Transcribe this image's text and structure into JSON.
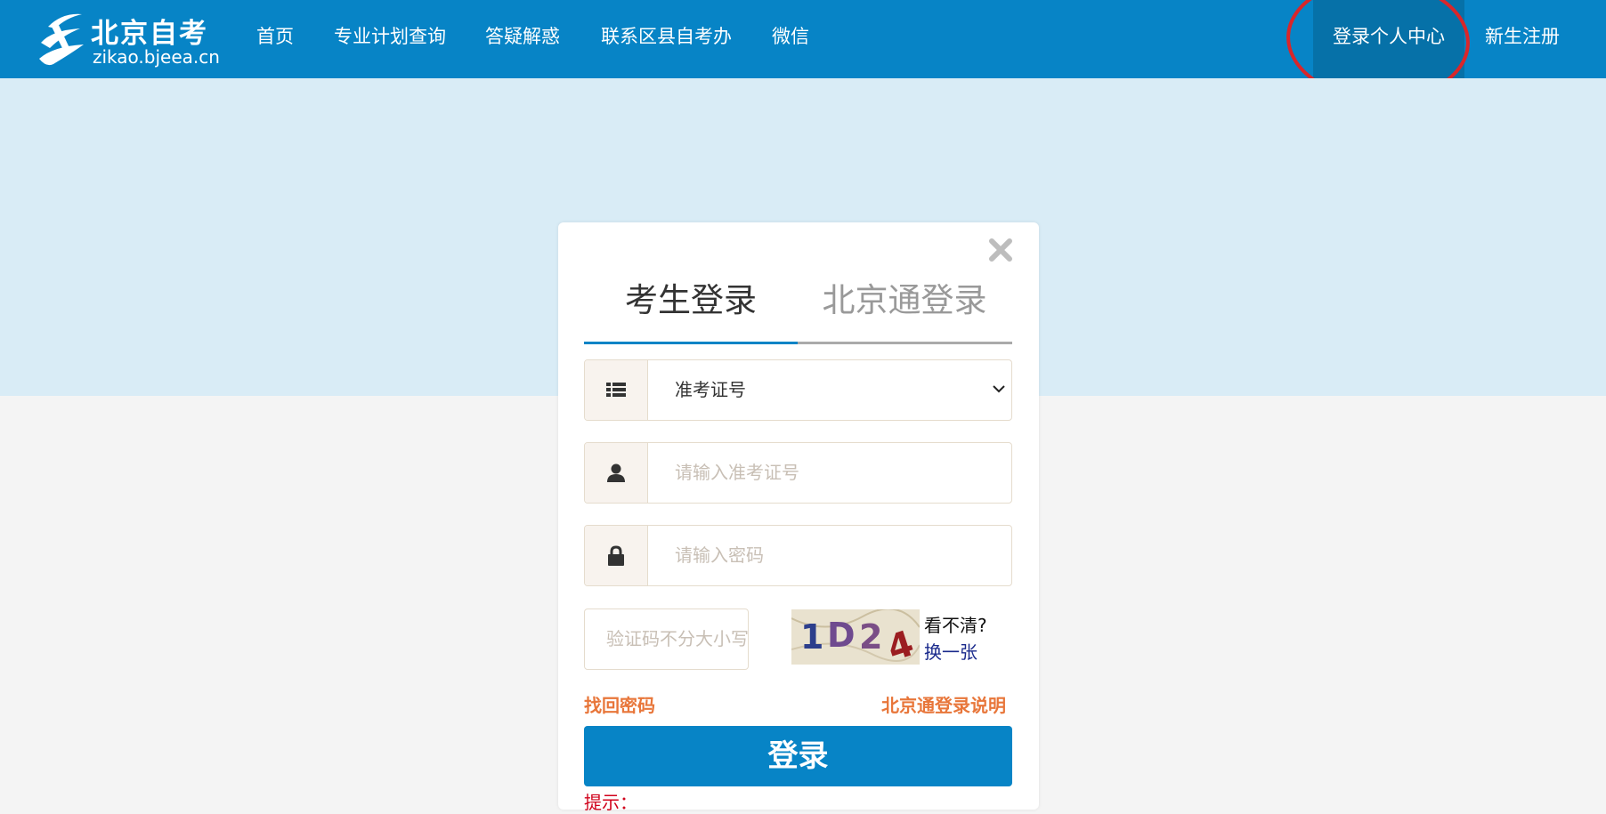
{
  "brand": {
    "title": "北京自考",
    "domain": "zikao.bjeea.cn"
  },
  "nav": {
    "items": [
      "首页",
      "专业计划查询",
      "答疑解惑",
      "联系区县自考办",
      "微信"
    ],
    "login_center": "登录个人中心",
    "register": "新生注册"
  },
  "login": {
    "tabs": [
      "考生登录",
      "北京通登录"
    ],
    "id_type": {
      "selected": "准考证号"
    },
    "exam_number": {
      "placeholder": "请输入准考证号"
    },
    "password": {
      "placeholder": "请输入密码"
    },
    "captcha": {
      "placeholder": "验证码不分大小写",
      "image_text": "1D24",
      "hint": "看不清?",
      "refresh": "换一张"
    },
    "forgot_password": "找回密码",
    "bjt_help": "北京通登录说明",
    "submit": "登录",
    "tip": "提示："
  },
  "colors": {
    "nav_bg": "#0784c6",
    "nav_active_bg": "#0671a8",
    "hero_bg": "#d9ecf6",
    "accent_orange": "#e8763a",
    "highlight_ring": "#d9262a"
  },
  "icons": [
    "logo-mark",
    "list-icon",
    "user-icon",
    "lock-icon",
    "close-icon",
    "chevron-down-icon"
  ]
}
